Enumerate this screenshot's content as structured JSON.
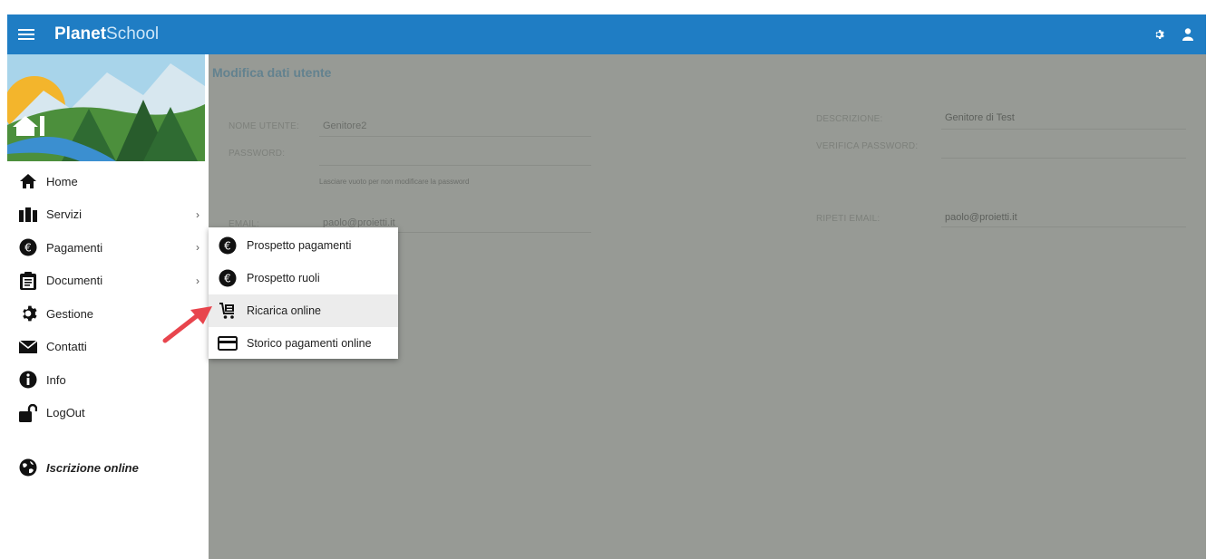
{
  "header": {
    "brand_bold": "Planet",
    "brand_light": "School",
    "icons": [
      "menu-icon",
      "settings-icon",
      "user-icon"
    ]
  },
  "sidebar": {
    "items": [
      {
        "label": "Home",
        "icon": "home-icon",
        "has_submenu": false
      },
      {
        "label": "Servizi",
        "icon": "briefcase-icon",
        "has_submenu": true
      },
      {
        "label": "Pagamenti",
        "icon": "euro-icon",
        "has_submenu": true
      },
      {
        "label": "Documenti",
        "icon": "clipboard-icon",
        "has_submenu": true
      },
      {
        "label": "Gestione",
        "icon": "gear-icon",
        "has_submenu": false
      },
      {
        "label": "Contatti",
        "icon": "envelope-icon",
        "has_submenu": false
      },
      {
        "label": "Info",
        "icon": "info-icon",
        "has_submenu": false
      },
      {
        "label": "LogOut",
        "icon": "unlock-icon",
        "has_submenu": false
      }
    ],
    "iscrizione_label": "Iscrizione online"
  },
  "main": {
    "title": "Modifica dati utente",
    "nome_utente_label": "NOME UTENTE:",
    "nome_utente_value": "Genitore2",
    "password_label": "PASSWORD:",
    "password_hint": "Lasciare vuoto per non modificare la password",
    "email_label": "EMAIL:",
    "email_value": "paolo@proietti.it",
    "descrizione_label": "DESCRIZIONE:",
    "descrizione_value": "Genitore di Test",
    "verifica_password_label": "VERIFICA PASSWORD:",
    "ripeti_email_label": "RIPETI EMAIL:",
    "ripeti_email_value": "paolo@proietti.it"
  },
  "submenu": {
    "items": [
      {
        "label": "Prospetto pagamenti",
        "icon": "euro-icon"
      },
      {
        "label": "Prospetto ruoli",
        "icon": "euro-icon"
      },
      {
        "label": "Ricarica online",
        "icon": "cart-icon",
        "active": true
      },
      {
        "label": "Storico pagamenti online",
        "icon": "credit-card-icon"
      }
    ]
  },
  "colors": {
    "topbar": "#1f7dc4",
    "overlay": "#979a95",
    "annotation_arrow": "#e8454d"
  }
}
